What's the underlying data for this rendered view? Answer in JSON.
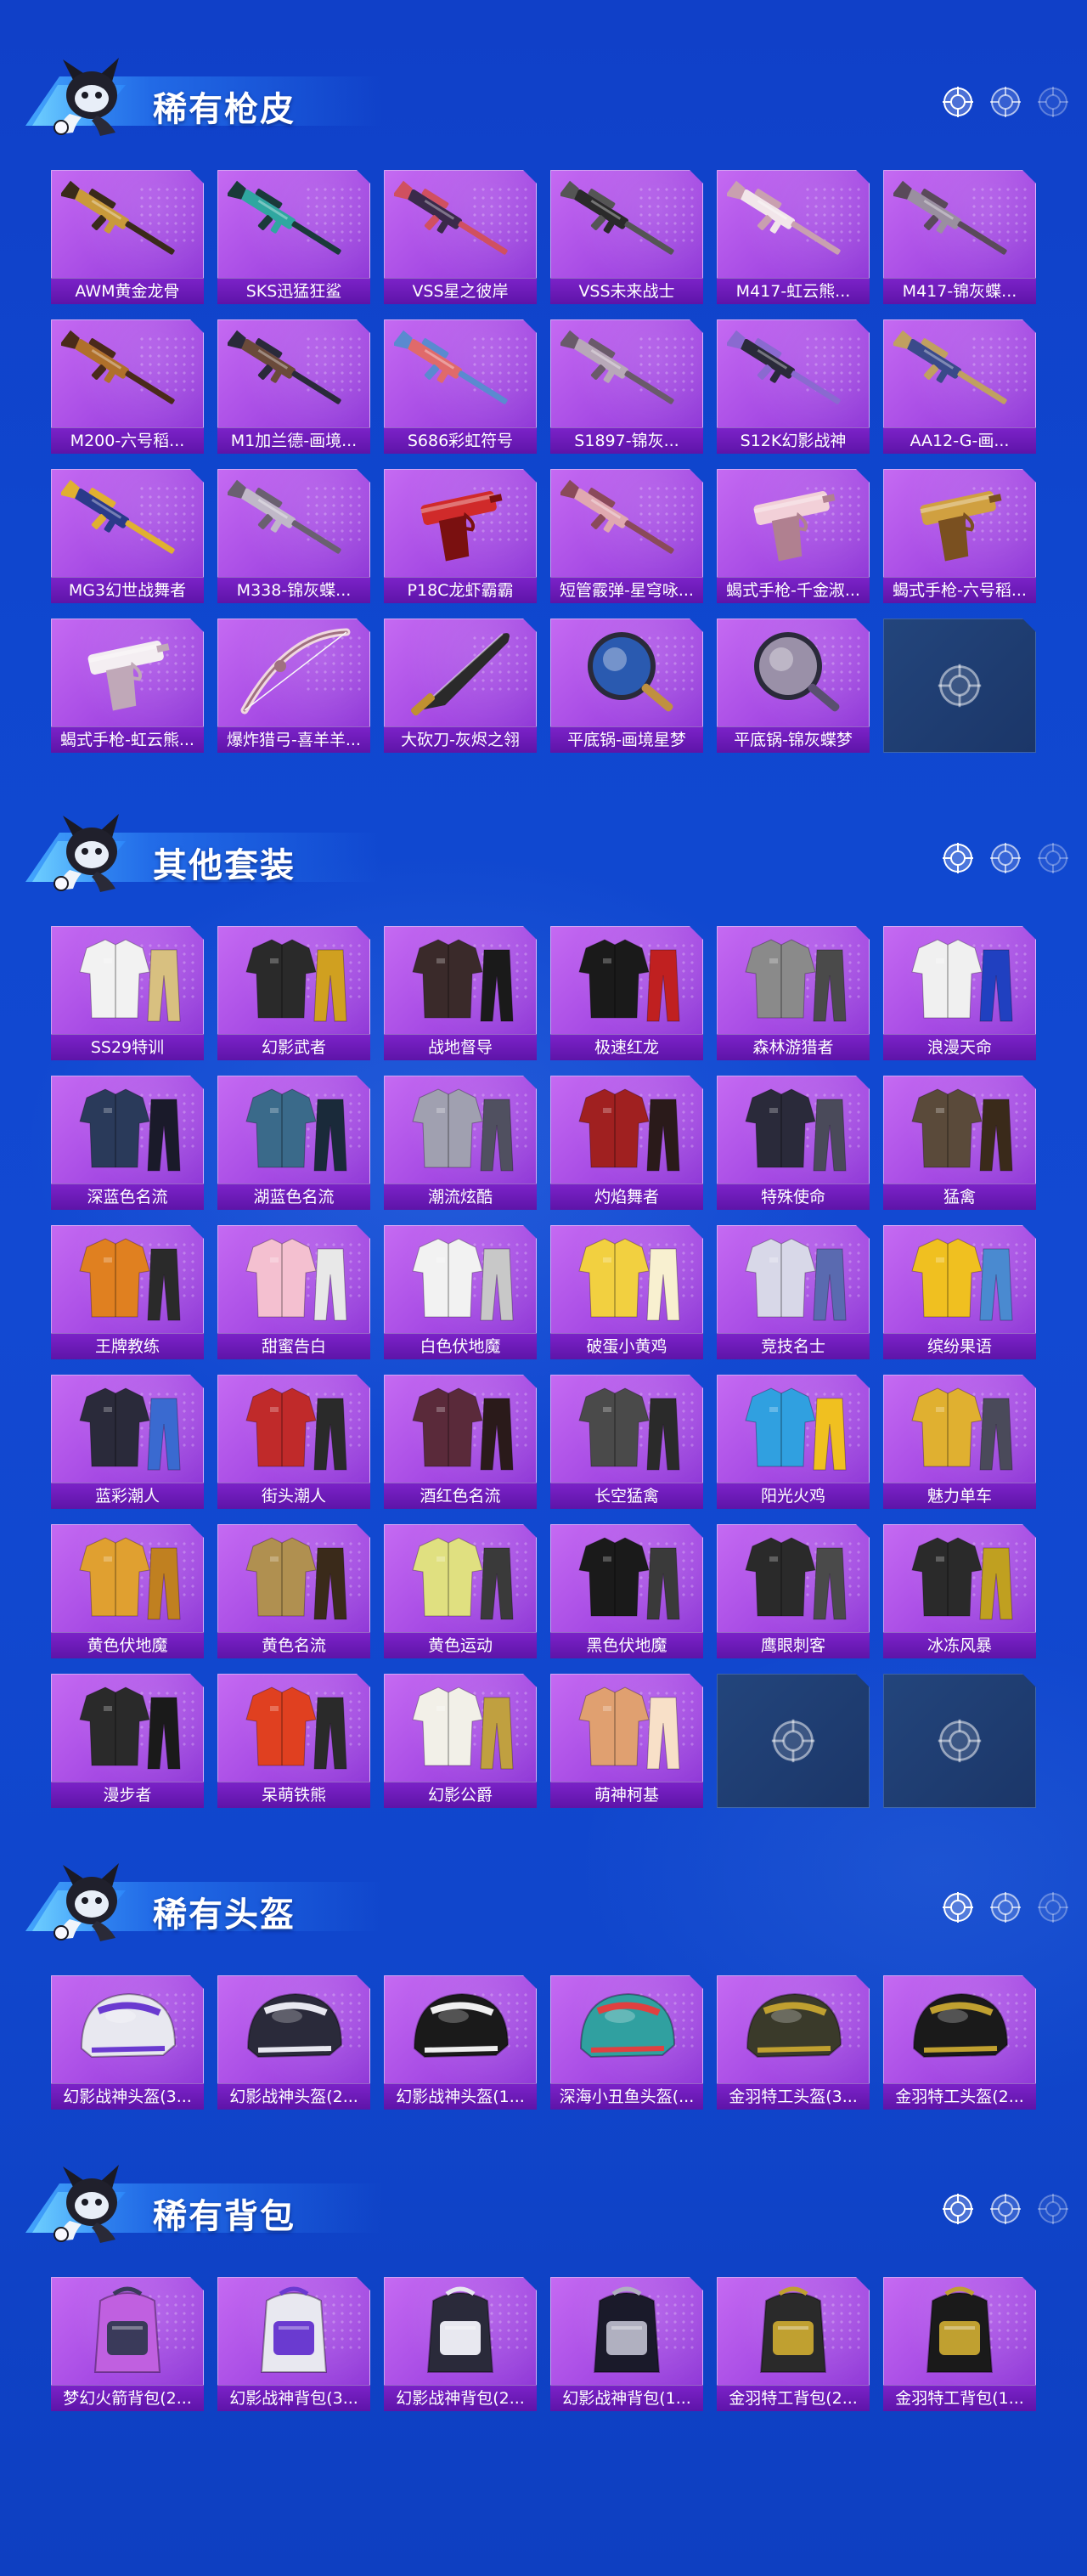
{
  "sections": [
    {
      "title": "稀有枪皮",
      "items": [
        {
          "label": "AWM黄金龙骨",
          "kind": "rifle",
          "c1": "#c99a3a",
          "c2": "#3a2a1a"
        },
        {
          "label": "SKS迅猛狂鲨",
          "kind": "rifle",
          "c1": "#2fa7a0",
          "c2": "#1a3a3a"
        },
        {
          "label": "VSS星之彼岸",
          "kind": "rifle",
          "c1": "#3a2a4a",
          "c2": "#d05060"
        },
        {
          "label": "VSS未来战士",
          "kind": "rifle",
          "c1": "#2a2a2a",
          "c2": "#555"
        },
        {
          "label": "M417-虹云熊...",
          "kind": "rifle",
          "c1": "#f2e6ea",
          "c2": "#c9a0b0"
        },
        {
          "label": "M417-锦灰蝶...",
          "kind": "rifle",
          "c1": "#9a8fa0",
          "c2": "#5a4a5a"
        },
        {
          "label": "M200-六号稻...",
          "kind": "rifle",
          "c1": "#b0702a",
          "c2": "#4a2a1a"
        },
        {
          "label": "M1加兰德-画境...",
          "kind": "rifle",
          "c1": "#6a4a3a",
          "c2": "#2a2a3a"
        },
        {
          "label": "S686彩虹符号",
          "kind": "rifle",
          "c1": "#e06a6a",
          "c2": "#5a8ad0"
        },
        {
          "label": "S1897-锦灰...",
          "kind": "rifle",
          "c1": "#b8a8b8",
          "c2": "#6a5a6a"
        },
        {
          "label": "S12K幻影战神",
          "kind": "rifle",
          "c1": "#2a2a3a",
          "c2": "#8a6ad0"
        },
        {
          "label": "AA12-G-画...",
          "kind": "rifle",
          "c1": "#3a4a8a",
          "c2": "#c0a060"
        },
        {
          "label": "MG3幻世战舞者",
          "kind": "rifle",
          "c1": "#2a3a8a",
          "c2": "#e0b030"
        },
        {
          "label": "M338-锦灰蝶...",
          "kind": "rifle",
          "c1": "#c0b8c8",
          "c2": "#6a6070"
        },
        {
          "label": "P18C龙虾霸霸",
          "kind": "pistol",
          "c1": "#d02a2a",
          "c2": "#7a1010"
        },
        {
          "label": "短管霰弹-星穹咏...",
          "kind": "rifle",
          "c1": "#e0a8b0",
          "c2": "#8a4a5a"
        },
        {
          "label": "蝎式手枪-千金淑...",
          "kind": "pistol",
          "c1": "#f2d0d8",
          "c2": "#b08090"
        },
        {
          "label": "蝎式手枪-六号稻...",
          "kind": "pistol",
          "c1": "#d0a040",
          "c2": "#7a5020"
        },
        {
          "label": "蝎式手枪-虹云熊...",
          "kind": "pistol",
          "c1": "#f4eef2",
          "c2": "#c0a8b8"
        },
        {
          "label": "爆炸猎弓-喜羊羊...",
          "kind": "bow",
          "c1": "#f0d8e0",
          "c2": "#a07080"
        },
        {
          "label": "大砍刀-灰烬之翎",
          "kind": "blade",
          "c1": "#2a2a2a",
          "c2": "#c09030"
        },
        {
          "label": "平底锅-画境星梦",
          "kind": "pan",
          "c1": "#2a5ab0",
          "c2": "#c09040"
        },
        {
          "label": "平底锅-锦灰蝶梦",
          "kind": "pan",
          "c1": "#9a90a8",
          "c2": "#5a5070"
        },
        {
          "label": "",
          "kind": "empty"
        }
      ]
    },
    {
      "title": "其他套装",
      "items": [
        {
          "label": "SS29特训",
          "kind": "outfit",
          "c1": "#f2f2f2",
          "c2": "#d8c080"
        },
        {
          "label": "幻影武者",
          "kind": "outfit",
          "c1": "#2a2a2a",
          "c2": "#d0a020"
        },
        {
          "label": "战地督导",
          "kind": "outfit",
          "c1": "#3a2a2a",
          "c2": "#1a1a1a"
        },
        {
          "label": "极速红龙",
          "kind": "outfit",
          "c1": "#1a1a1a",
          "c2": "#c02020"
        },
        {
          "label": "森林游猎者",
          "kind": "outfit",
          "c1": "#8a8a8a",
          "c2": "#4a4a4a"
        },
        {
          "label": "浪漫天命",
          "kind": "outfit",
          "c1": "#f0f0f0",
          "c2": "#2040c0"
        },
        {
          "label": "深蓝色名流",
          "kind": "outfit",
          "c1": "#2a3a5a",
          "c2": "#1a1a2a"
        },
        {
          "label": "湖蓝色名流",
          "kind": "outfit",
          "c1": "#3a6a8a",
          "c2": "#1a2a3a"
        },
        {
          "label": "潮流炫酷",
          "kind": "outfit",
          "c1": "#a0a0b0",
          "c2": "#505060"
        },
        {
          "label": "灼焰舞者",
          "kind": "outfit",
          "c1": "#a02020",
          "c2": "#2a1a1a"
        },
        {
          "label": "特殊使命",
          "kind": "outfit",
          "c1": "#2a2a3a",
          "c2": "#4a4a5a"
        },
        {
          "label": "猛禽",
          "kind": "outfit",
          "c1": "#5a4a3a",
          "c2": "#3a2a1a"
        },
        {
          "label": "王牌教练",
          "kind": "outfit",
          "c1": "#e08020",
          "c2": "#2a2a2a"
        },
        {
          "label": "甜蜜告白",
          "kind": "outfit",
          "c1": "#f4c0d0",
          "c2": "#e8e8e8"
        },
        {
          "label": "白色伏地魔",
          "kind": "outfit",
          "c1": "#f2f2f2",
          "c2": "#c8c8c8"
        },
        {
          "label": "破蛋小黄鸡",
          "kind": "outfit",
          "c1": "#f2d040",
          "c2": "#f8f0d0"
        },
        {
          "label": "竞技名士",
          "kind": "outfit",
          "c1": "#d8d8e8",
          "c2": "#5a6ab0"
        },
        {
          "label": "缤纷果语",
          "kind": "outfit",
          "c1": "#f0c020",
          "c2": "#4a8ad0"
        },
        {
          "label": "蓝彩潮人",
          "kind": "outfit",
          "c1": "#2a2a3a",
          "c2": "#3a6ad0"
        },
        {
          "label": "街头潮人",
          "kind": "outfit",
          "c1": "#c02a2a",
          "c2": "#2a2a2a"
        },
        {
          "label": "酒红色名流",
          "kind": "outfit",
          "c1": "#5a2a3a",
          "c2": "#2a1a1a"
        },
        {
          "label": "长空猛禽",
          "kind": "outfit",
          "c1": "#4a4a4a",
          "c2": "#2a2a2a"
        },
        {
          "label": "阳光火鸡",
          "kind": "outfit",
          "c1": "#30a0e0",
          "c2": "#f0c020"
        },
        {
          "label": "魅力单车",
          "kind": "outfit",
          "c1": "#e0b030",
          "c2": "#4a4a5a"
        },
        {
          "label": "黄色伏地魔",
          "kind": "outfit",
          "c1": "#e0a030",
          "c2": "#c08020"
        },
        {
          "label": "黄色名流",
          "kind": "outfit",
          "c1": "#b09050",
          "c2": "#3a2a1a"
        },
        {
          "label": "黄色运动",
          "kind": "outfit",
          "c1": "#e0e080",
          "c2": "#3a3a3a"
        },
        {
          "label": "黑色伏地魔",
          "kind": "outfit",
          "c1": "#1a1a1a",
          "c2": "#3a3a3a"
        },
        {
          "label": "鹰眼刺客",
          "kind": "outfit",
          "c1": "#2a2a2a",
          "c2": "#4a4a4a"
        },
        {
          "label": "冰冻风暴",
          "kind": "outfit",
          "c1": "#2a2a2a",
          "c2": "#c0a020"
        },
        {
          "label": "漫步者",
          "kind": "outfit",
          "c1": "#2a2a2a",
          "c2": "#1a1a1a"
        },
        {
          "label": "呆萌铁熊",
          "kind": "outfit",
          "c1": "#e04020",
          "c2": "#2a2a2a"
        },
        {
          "label": "幻影公爵",
          "kind": "outfit",
          "c1": "#f2f0e8",
          "c2": "#c0a040"
        },
        {
          "label": "萌神柯基",
          "kind": "outfit",
          "c1": "#e0a070",
          "c2": "#f8e0c8"
        },
        {
          "label": "",
          "kind": "empty"
        },
        {
          "label": "",
          "kind": "empty"
        }
      ]
    },
    {
      "title": "稀有头盔",
      "items": [
        {
          "label": "幻影战神头盔(3...",
          "kind": "helmet",
          "c1": "#e8e8f0",
          "c2": "#6a3ad0"
        },
        {
          "label": "幻影战神头盔(2...",
          "kind": "helmet",
          "c1": "#2a2a3a",
          "c2": "#e8e8f0"
        },
        {
          "label": "幻影战神头盔(1...",
          "kind": "helmet",
          "c1": "#1a1a1a",
          "c2": "#f0f0f0"
        },
        {
          "label": "深海小丑鱼头盔(...",
          "kind": "helmet",
          "c1": "#30a0a0",
          "c2": "#e04040"
        },
        {
          "label": "金羽特工头盔(3...",
          "kind": "helmet",
          "c1": "#3a3a2a",
          "c2": "#c0a030"
        },
        {
          "label": "金羽特工头盔(2...",
          "kind": "helmet",
          "c1": "#1a1a1a",
          "c2": "#c0a030"
        }
      ]
    },
    {
      "title": "稀有背包",
      "items": [
        {
          "label": "梦幻火箭背包(2...",
          "kind": "backpack",
          "c1": "#c060e0",
          "c2": "#3a3a5a"
        },
        {
          "label": "幻影战神背包(3...",
          "kind": "backpack",
          "c1": "#e8e8f0",
          "c2": "#6a3ad0"
        },
        {
          "label": "幻影战神背包(2...",
          "kind": "backpack",
          "c1": "#2a2a3a",
          "c2": "#e8e8f0"
        },
        {
          "label": "幻影战神背包(1...",
          "kind": "backpack",
          "c1": "#1a1a2a",
          "c2": "#b0b0c0"
        },
        {
          "label": "金羽特工背包(2...",
          "kind": "backpack",
          "c1": "#2a2a2a",
          "c2": "#c0a030"
        },
        {
          "label": "金羽特工背包(1...",
          "kind": "backpack",
          "c1": "#1a1a1a",
          "c2": "#c0a030"
        }
      ]
    }
  ]
}
